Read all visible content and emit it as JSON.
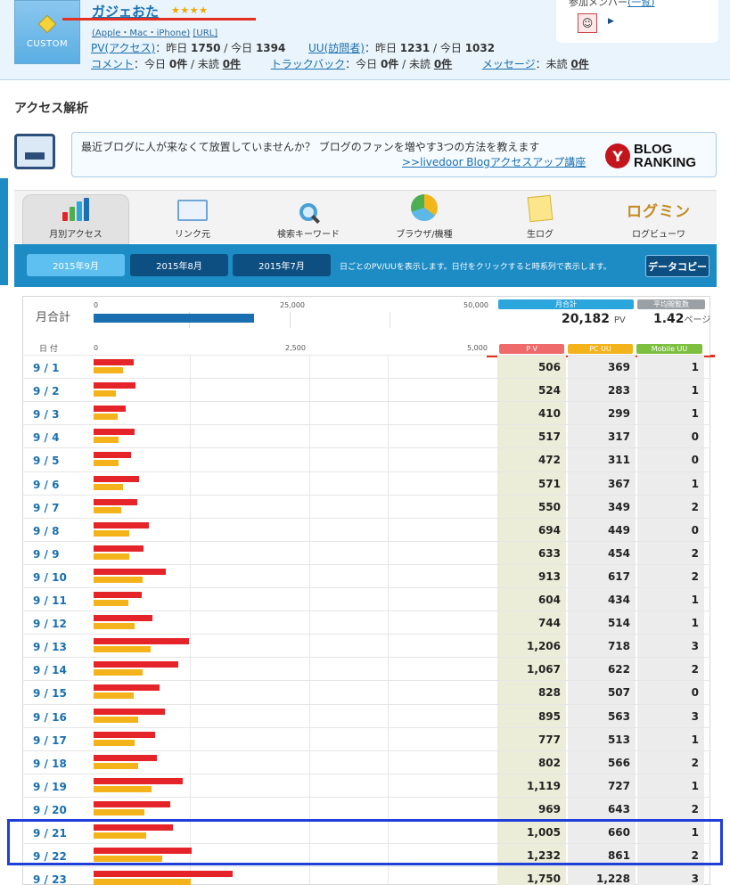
{
  "header": {
    "badge_label": "CUSTOM",
    "blog_title": "ガジェおた",
    "stars": "★★★★",
    "devices": "(Apple・Mac・iPhone)",
    "url_label": "[URL]",
    "pv_label": "PV(アクセス)",
    "pv_text": "：昨日 ",
    "pv_yesterday": "1750",
    "pv_sep": " / 今日 ",
    "pv_today": "1394",
    "uu_label": "UU(訪問者)",
    "uu_yesterday": "1231",
    "uu_today": "1032",
    "comment_label": "コメント",
    "comment_text": "：今日 ",
    "comment_today": "0件",
    "comment_unread_text": " / 未読 ",
    "comment_unread": "0件",
    "trackback_label": "トラックバック",
    "trackback_today": "0件",
    "trackback_unread": "0件",
    "message_label": "メッセージ",
    "message_text": "：未読 ",
    "message_unread": "0件",
    "members_label": "参加メンバー",
    "members_link": "(一覧)"
  },
  "section_title": "アクセス解析",
  "promo": {
    "message": "最近ブログに人が来なくて放置していませんか？ ブログのファンを増やす3つの方法を教えます",
    "link": ">>livedoor Blogアクセスアップ講座",
    "rank_line1": "BLOG",
    "rank_line2": "RANKING"
  },
  "tabs": [
    {
      "label": "月別アクセス",
      "icon": "bar-chart-icon"
    },
    {
      "label": "リンク元",
      "icon": "window-icon"
    },
    {
      "label": "検索キーワード",
      "icon": "magnifier-icon"
    },
    {
      "label": "ブラウザ/機種",
      "icon": "pie-icon"
    },
    {
      "label": "生ログ",
      "icon": "memo-icon"
    },
    {
      "label": "ログビューワ",
      "icon": "logvu-icon",
      "logo_text": "ログミン"
    }
  ],
  "months": [
    "2015年9月",
    "2015年8月",
    "2015年7月"
  ],
  "month_note": "日ごとのPV/UUを表示します。日付をクリックすると時系列で表示します。",
  "copy_button": "データコピー",
  "summary": {
    "label": "月合計",
    "axis_ticks": [
      "0",
      "25,000",
      "50,000"
    ],
    "pv_total": 20182,
    "pv_total_text": "20,182",
    "pv_unit": "PV",
    "total_header": "月合計",
    "avg_header": "平均閲覧数",
    "avg_value": "1.42",
    "avg_unit": "ページ"
  },
  "table": {
    "date_header": "日 付",
    "axis_ticks": [
      "0",
      "2,500",
      "5,000"
    ],
    "col_pv": "P V",
    "col_pc": "PC UU",
    "col_mobile": "Mobile UU",
    "colors": {
      "pv": "#e5242a",
      "pc": "#f4b21b",
      "mobile": "#7dbf3f",
      "total": "#2aa6dd",
      "avg": "#9aa0a4"
    },
    "rows": [
      {
        "date": "9 / 1",
        "pv": 506,
        "pv_text": "506",
        "pc": 369,
        "pc_text": "369",
        "mobile": "1"
      },
      {
        "date": "9 / 2",
        "pv": 524,
        "pv_text": "524",
        "pc": 283,
        "pc_text": "283",
        "mobile": "1"
      },
      {
        "date": "9 / 3",
        "pv": 410,
        "pv_text": "410",
        "pc": 299,
        "pc_text": "299",
        "mobile": "1"
      },
      {
        "date": "9 / 4",
        "pv": 517,
        "pv_text": "517",
        "pc": 317,
        "pc_text": "317",
        "mobile": "0"
      },
      {
        "date": "9 / 5",
        "pv": 472,
        "pv_text": "472",
        "pc": 311,
        "pc_text": "311",
        "mobile": "0"
      },
      {
        "date": "9 / 6",
        "pv": 571,
        "pv_text": "571",
        "pc": 367,
        "pc_text": "367",
        "mobile": "1"
      },
      {
        "date": "9 / 7",
        "pv": 550,
        "pv_text": "550",
        "pc": 349,
        "pc_text": "349",
        "mobile": "2"
      },
      {
        "date": "9 / 8",
        "pv": 694,
        "pv_text": "694",
        "pc": 449,
        "pc_text": "449",
        "mobile": "0"
      },
      {
        "date": "9 / 9",
        "pv": 633,
        "pv_text": "633",
        "pc": 454,
        "pc_text": "454",
        "mobile": "2"
      },
      {
        "date": "9 / 10",
        "pv": 913,
        "pv_text": "913",
        "pc": 617,
        "pc_text": "617",
        "mobile": "2"
      },
      {
        "date": "9 / 11",
        "pv": 604,
        "pv_text": "604",
        "pc": 434,
        "pc_text": "434",
        "mobile": "1"
      },
      {
        "date": "9 / 12",
        "pv": 744,
        "pv_text": "744",
        "pc": 514,
        "pc_text": "514",
        "mobile": "1"
      },
      {
        "date": "9 / 13",
        "pv": 1206,
        "pv_text": "1,206",
        "pc": 718,
        "pc_text": "718",
        "mobile": "3"
      },
      {
        "date": "9 / 14",
        "pv": 1067,
        "pv_text": "1,067",
        "pc": 622,
        "pc_text": "622",
        "mobile": "2"
      },
      {
        "date": "9 / 15",
        "pv": 828,
        "pv_text": "828",
        "pc": 507,
        "pc_text": "507",
        "mobile": "0"
      },
      {
        "date": "9 / 16",
        "pv": 895,
        "pv_text": "895",
        "pc": 563,
        "pc_text": "563",
        "mobile": "3"
      },
      {
        "date": "9 / 17",
        "pv": 777,
        "pv_text": "777",
        "pc": 513,
        "pc_text": "513",
        "mobile": "1"
      },
      {
        "date": "9 / 18",
        "pv": 802,
        "pv_text": "802",
        "pc": 566,
        "pc_text": "566",
        "mobile": "2"
      },
      {
        "date": "9 / 19",
        "pv": 1119,
        "pv_text": "1,119",
        "pc": 727,
        "pc_text": "727",
        "mobile": "1"
      },
      {
        "date": "9 / 20",
        "pv": 969,
        "pv_text": "969",
        "pc": 643,
        "pc_text": "643",
        "mobile": "2"
      },
      {
        "date": "9 / 21",
        "pv": 1005,
        "pv_text": "1,005",
        "pc": 660,
        "pc_text": "660",
        "mobile": "1"
      },
      {
        "date": "9 / 22",
        "pv": 1232,
        "pv_text": "1,232",
        "pc": 861,
        "pc_text": "861",
        "mobile": "2"
      },
      {
        "date": "9 / 23",
        "pv": 1750,
        "pv_text": "1,750",
        "pc": 1228,
        "pc_text": "1,228",
        "mobile": "3"
      }
    ]
  },
  "chart_data": {
    "type": "bar",
    "categories": [
      "9 / 1",
      "9 / 2",
      "9 / 3",
      "9 / 4",
      "9 / 5",
      "9 / 6",
      "9 / 7",
      "9 / 8",
      "9 / 9",
      "9 / 10",
      "9 / 11",
      "9 / 12",
      "9 / 13",
      "9 / 14",
      "9 / 15",
      "9 / 16",
      "9 / 17",
      "9 / 18",
      "9 / 19",
      "9 / 20",
      "9 / 21",
      "9 / 22",
      "9 / 23"
    ],
    "series": [
      {
        "name": "P V",
        "values": [
          506,
          524,
          410,
          517,
          472,
          571,
          550,
          694,
          633,
          913,
          604,
          744,
          1206,
          1067,
          828,
          895,
          777,
          802,
          1119,
          969,
          1005,
          1232,
          1750
        ]
      },
      {
        "name": "PC UU",
        "values": [
          369,
          283,
          299,
          317,
          311,
          367,
          349,
          449,
          454,
          617,
          434,
          514,
          718,
          622,
          507,
          563,
          513,
          566,
          727,
          643,
          660,
          861,
          1228
        ]
      }
    ],
    "orientation": "horizontal",
    "xlim": [
      0,
      5000
    ],
    "xticks": [
      "0",
      "2,500",
      "5,000"
    ]
  }
}
